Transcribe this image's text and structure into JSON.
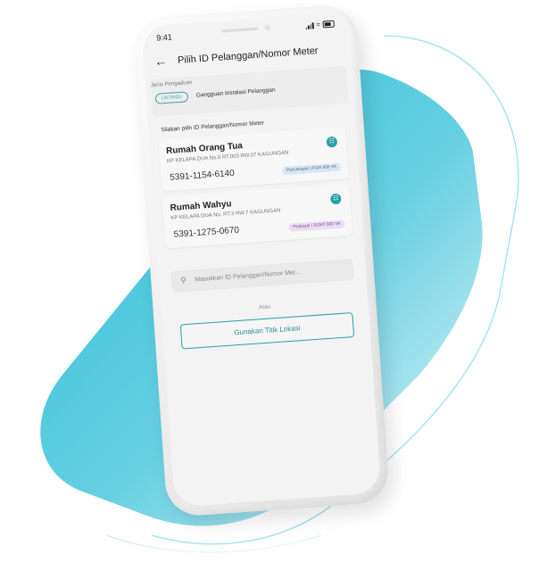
{
  "status_bar": {
    "time": "9:41"
  },
  "header": {
    "back_icon": "arrow-left-icon",
    "title": "Pilih ID Pelanggan/Nomor Meter"
  },
  "complaint": {
    "label": "Jenis Pengaduan",
    "chip": "LISTRIQU",
    "value": "Gangguan Instalasi Pelanggan"
  },
  "prompt": "Silakan pilih ID Pelanggan/Nomor Meter",
  "customers": [
    {
      "name": "Rumah Orang Tua",
      "address": "KP KELAPA DUA No.0 RT.003 RW.07 KAGUNGAN",
      "number": "5391-1154-6140",
      "tag": "Pascabayar | R1M 900 VA",
      "icon": "electricity-meter-icon"
    },
    {
      "name": "Rumah Wahyu",
      "address": "KP KELAPA DUA No. RT.3 RW.7 KAGUNGAN",
      "number": "5391-1275-0670",
      "tag": "Prabayar | R1MT 900 VA",
      "icon": "electricity-meter-icon"
    }
  ],
  "search": {
    "placeholder": "Masukkan ID Pelanggan/Nomor Met...",
    "icon": "search-icon"
  },
  "divider_text": "Atau",
  "location_button": "Gunakan Titik Lokasi",
  "colors": {
    "accent": "#2aa0a8",
    "background_shape": "#33c3d6"
  }
}
